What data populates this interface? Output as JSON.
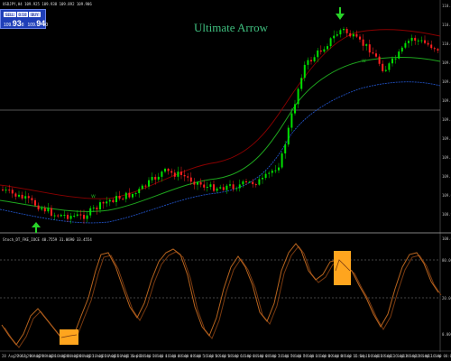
{
  "window": {
    "header": "USDJPY,H4  109.925 109.938 109.892 109.906",
    "indicator_header": "Stoch_DT_FKE_IOCE  40.7559 31.0690 33.4554"
  },
  "trade_panel": {
    "symbol_button": "SELL",
    "lots_value": "0.10",
    "buy_button": "BUY",
    "sell_price_prefix": "109.",
    "sell_price_big": "93",
    "sell_price_small": "8",
    "buy_price_prefix": "109.",
    "buy_price_big": "94",
    "buy_price_small": "0"
  },
  "title": "Ultimate Arrow",
  "price_axis": [
    "110.350",
    "110.220",
    "110.090",
    "109.960",
    "109.830",
    "109.700",
    "109.570",
    "109.440",
    "109.310",
    "109.180",
    "109.050",
    "108.920"
  ],
  "indicator_axis": [
    "100.000",
    "80.000",
    "20.000",
    "0.000"
  ],
  "time_axis": [
    "28 Aug 2017",
    "29 Aug 00:00",
    "29 Aug 08:00",
    "29 Aug 16:00",
    "30 Aug 00:00",
    "30 Aug 08:00",
    "30 Aug 16:00",
    "31 Aug 00:00",
    "31 Aug 08:00",
    "31 Aug 16:00",
    "1 Sep 00:00",
    "1 Sep 08:00",
    "1 Sep 16:00",
    "4 Sep 00:00",
    "4 Sep 08:00",
    "4 Sep 16:00",
    "5 Sep 00:00",
    "5 Sep 08:00",
    "5 Sep 16:00",
    "6 Sep 00:00",
    "6 Sep 08:00",
    "6 Sep 16:00",
    "7 Sep 00:00",
    "7 Sep 08:00",
    "7 Sep 16:00",
    "8 Sep 00:00",
    "8 Sep 08:00",
    "8 Sep 16:00",
    "11 Sep 00:00",
    "11 Sep 08:00",
    "11 Sep 16:00",
    "12 Sep 00:00",
    "12 Sep 08:00",
    "12 Sep 16:00",
    "13 Sep 00:00"
  ],
  "markers": {
    "w1": "w",
    "w2": "w"
  },
  "colors": {
    "bull": "#00e000",
    "bear": "#ff2020",
    "upper_band": "#8b0000",
    "middle_band": "#1ea51e",
    "lower_band": "#2050c0",
    "arrow": "#28d428",
    "stoch_main": "#b8641e",
    "stoch_signal": "#7a3a10",
    "highlight": "#ffa51e"
  }
}
